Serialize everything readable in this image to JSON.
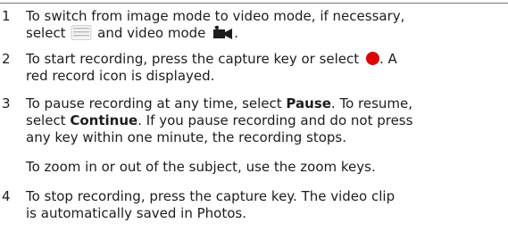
{
  "steps": [
    {
      "number": "1",
      "line1": "To switch from image mode to video mode, if necessary,",
      "line2_prefix": "select",
      "line2_mid": "and video mode",
      "line2_suffix": ".",
      "icons": [
        "menu-icon",
        "video-camera-icon"
      ]
    },
    {
      "number": "2",
      "line1_prefix": "To start recording, press the capture key or select",
      "line1_suffix": ". A",
      "line2": "red record icon is displayed.",
      "icons": [
        "record-icon"
      ],
      "record_color": "#e00000"
    },
    {
      "number": "3",
      "l1_prefix": "To pause recording at any time, select ",
      "l1_bold": "Pause",
      "l1_suffix": ". To resume,",
      "l2_prefix": "select ",
      "l2_bold": "Continue",
      "l2_suffix": ". If you pause recording and do not press",
      "line3": "any key within one minute, the recording stops.",
      "note": "To zoom in or out of the subject, use the zoom keys."
    },
    {
      "number": "4",
      "line1": "To stop recording, press the capture key. The video clip",
      "line2": "is automatically saved in Photos."
    }
  ]
}
